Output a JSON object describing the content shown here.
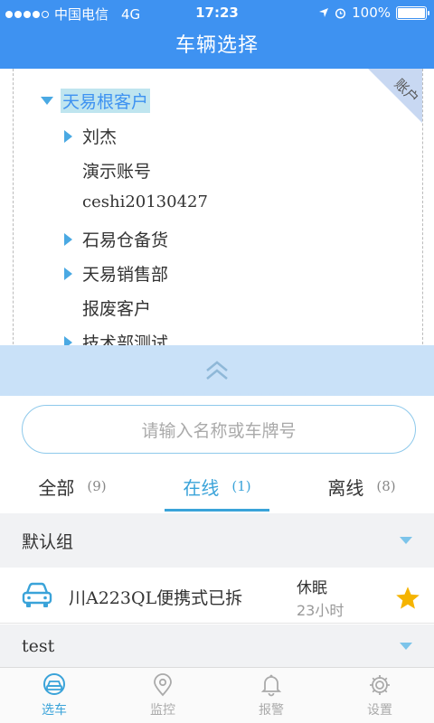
{
  "status_bar": {
    "carrier": "中国电信",
    "network": "4G",
    "time": "17:23",
    "battery": "100%",
    "battery_level": 1.0,
    "signal_bars_filled": 4
  },
  "title": "车辆选择",
  "tree": {
    "corner_tag": "账户",
    "root": "天易根客户",
    "items": [
      {
        "label": "刘杰",
        "expandable": true
      },
      {
        "label": "演示账号",
        "expandable": false
      },
      {
        "label": "ceshi20130427",
        "expandable": false
      },
      {
        "label": "石易仓备货",
        "expandable": true
      },
      {
        "label": "天易销售部",
        "expandable": true
      },
      {
        "label": "报废客户",
        "expandable": false
      },
      {
        "label": "技术部测试",
        "expandable": true
      }
    ]
  },
  "search": {
    "placeholder": "请输入名称或车牌号"
  },
  "tabs": [
    {
      "label": "全部",
      "count": "(9)",
      "active": false
    },
    {
      "label": "在线",
      "count": "(1)",
      "active": true
    },
    {
      "label": "离线",
      "count": "(8)",
      "active": false
    }
  ],
  "groups": [
    {
      "name": "默认组"
    },
    {
      "name": "test"
    }
  ],
  "vehicle": {
    "name": "川A223QL便携式已拆",
    "status": "休眠",
    "duration": "23小时",
    "starred": true
  },
  "nav": [
    {
      "label": "选车",
      "icon": "car-select-icon",
      "active": true
    },
    {
      "label": "监控",
      "icon": "location-pin-icon",
      "active": false
    },
    {
      "label": "报警",
      "icon": "bell-icon",
      "active": false
    },
    {
      "label": "设置",
      "icon": "gear-icon",
      "active": false
    }
  ],
  "colors": {
    "primary": "#3e92f1",
    "accent": "#3aa3d9",
    "star": "#f5b400"
  }
}
